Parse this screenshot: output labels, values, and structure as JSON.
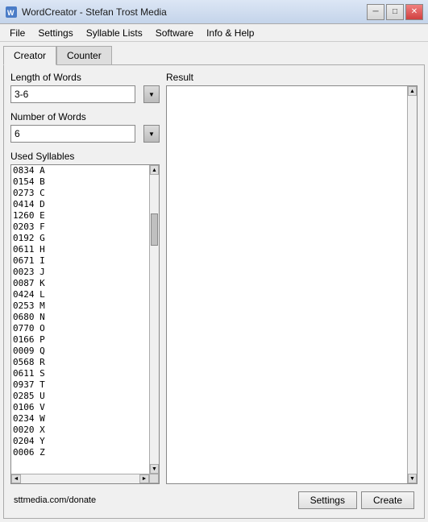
{
  "titlebar": {
    "title": "WordCreator - Stefan Trost Media",
    "minimize_label": "─",
    "maximize_label": "□",
    "close_label": "✕"
  },
  "menubar": {
    "items": [
      {
        "label": "File",
        "id": "file"
      },
      {
        "label": "Settings",
        "id": "settings"
      },
      {
        "label": "Syllable Lists",
        "id": "syllable-lists"
      },
      {
        "label": "Software",
        "id": "software"
      },
      {
        "label": "Info & Help",
        "id": "info-help"
      }
    ]
  },
  "tabs": [
    {
      "label": "Creator",
      "id": "creator",
      "active": true
    },
    {
      "label": "Counter",
      "id": "counter",
      "active": false
    }
  ],
  "left": {
    "length_label": "Length of Words",
    "length_value": "3-6",
    "number_label": "Number of Words",
    "number_value": "6",
    "syllables_label": "Used Syllables",
    "syllables": [
      "0834 A",
      "0154 B",
      "0273 C",
      "0414 D",
      "1260 E",
      "0203 F",
      "0192 G",
      "0611 H",
      "0671 I",
      "0023 J",
      "0087 K",
      "0424 L",
      "0253 M",
      "0680 N",
      "0770 O",
      "0166 P",
      "0009 Q",
      "0568 R",
      "0611 S",
      "0937 T",
      "0285 U",
      "0106 V",
      "0234 W",
      "0020 X",
      "0204 Y",
      "0006 Z"
    ]
  },
  "right": {
    "result_label": "Result"
  },
  "footer": {
    "link": "sttmedia.com/donate",
    "settings_label": "Settings",
    "create_label": "Create"
  }
}
